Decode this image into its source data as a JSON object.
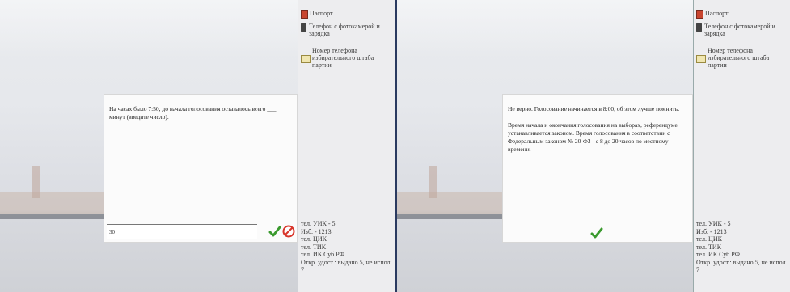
{
  "sidebar": {
    "items": {
      "passport": "Паспорт",
      "phone_left": "Телефон с фотокамерой и зарядка",
      "phone_right": "Телефон с фотокамерой и зарядка",
      "hq_phone_left": "Номер телефона избирательного штаба партии",
      "hq_phone_right": "Номер телефона избирательного штаба партии"
    },
    "info_left": [
      "тел. УИК - 5",
      "Изб. - 1213",
      "тел. ЦИК",
      "тел. ТИК",
      "тел. ИК Суб.РФ",
      "Откр. удост.: выдано 5, не испол. 7"
    ],
    "info_right": [
      "тел. УИК - 5",
      "Изб. - 1213",
      "тел. ЦИК",
      "тел. ТИК",
      "тел. ИК Суб.РФ",
      "Откр. удост.: выдано 5, не испол. 7"
    ]
  },
  "left_dialog": {
    "question": "На часах было 7:50, до начала голосования оставалось всего ___ минут (введите число).",
    "answer_value": "30"
  },
  "right_dialog": {
    "feedback": "Не верно. Голосование начинается в 8:00, об этом лучше помнить.",
    "explanation": "Время начала и окончания голосования на выборах, референдуме устанавливается законом. Время голосования в соответствии с Федеральным законом № 20-ФЗ - с 8 до 20 часов по местному времени."
  },
  "icons": {
    "passport": "passport-icon",
    "phone": "phone-icon",
    "card": "id-card-icon",
    "ok": "checkmark-icon",
    "cancel": "no-entry-icon"
  },
  "colors": {
    "ok": "#3a9a2e",
    "cancel": "#d8352a",
    "border": "#2a3a60"
  }
}
